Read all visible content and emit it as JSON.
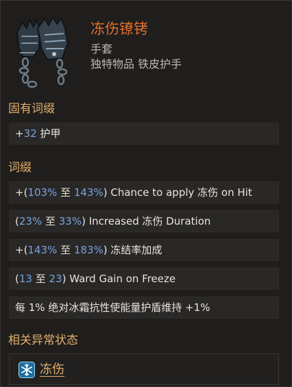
{
  "item": {
    "name": "冻伤镣铐",
    "type": "手套",
    "subtitle": "独特物品 铁皮护手"
  },
  "implicit": {
    "title": "固有词缀",
    "mod": {
      "prefix": "+",
      "value": "32",
      "text": " 护甲"
    }
  },
  "affixes": {
    "title": "词缀",
    "mods": [
      {
        "p1": "+(",
        "v1": "103%",
        "mid": " 至 ",
        "v2": "143%",
        "text": ") Chance to apply 冻伤 on Hit"
      },
      {
        "p1": "(",
        "v1": "23%",
        "mid": " 至 ",
        "v2": "33%",
        "text": ") Increased 冻伤 Duration"
      },
      {
        "p1": "+(",
        "v1": "143%",
        "mid": " 至 ",
        "v2": "183%",
        "text": ") 冻结率加成"
      },
      {
        "p1": "(",
        "v1": "13",
        "mid": " 至 ",
        "v2": "23",
        "text": ") Ward Gain on Freeze"
      }
    ],
    "special": "每 1% 绝对冰霜抗性使能量护盾维持 +1%"
  },
  "related": {
    "title": "相关异常状态",
    "ailment": "冻伤"
  },
  "colors": {
    "item_name": "#e0702a",
    "section_title": "#e2ae6a",
    "value_blue": "#79a3e0",
    "text": "#e9e5dd"
  },
  "icons": {
    "item": "gauntlets-with-chain-icon",
    "ailment": "snowflake-icon"
  }
}
